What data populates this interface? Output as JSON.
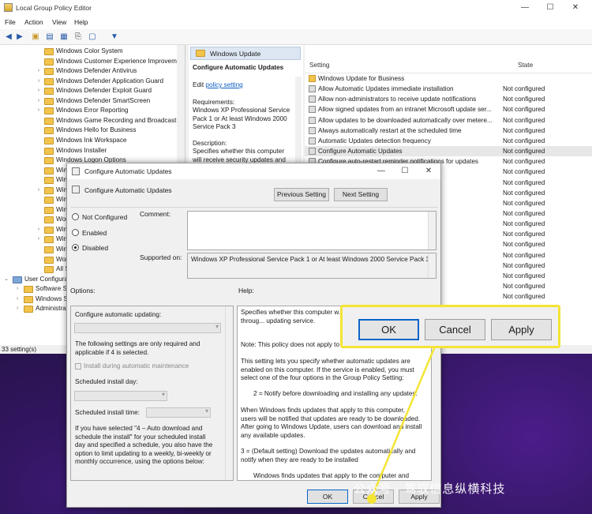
{
  "window": {
    "title": "Local Group Policy Editor",
    "minimize": "—",
    "maximize": "☐",
    "close": "✕"
  },
  "menu": [
    "File",
    "Action",
    "View",
    "Help"
  ],
  "tree": {
    "items": [
      {
        "label": "Windows Color System",
        "chev": ""
      },
      {
        "label": "Windows Customer Experience Improvem",
        "chev": ""
      },
      {
        "label": "Windows Defender Antivirus",
        "chev": "›"
      },
      {
        "label": "Windows Defender Application Guard",
        "chev": "›"
      },
      {
        "label": "Windows Defender Exploit Guard",
        "chev": "›"
      },
      {
        "label": "Windows Defender SmartScreen",
        "chev": "›"
      },
      {
        "label": "Windows Error Reporting",
        "chev": "›"
      },
      {
        "label": "Windows Game Recording and Broadcasti",
        "chev": ""
      },
      {
        "label": "Windows Hello for Business",
        "chev": ""
      },
      {
        "label": "Windows Ink Workspace",
        "chev": ""
      },
      {
        "label": "Windows Installer",
        "chev": ""
      },
      {
        "label": "Windows Logon Options",
        "chev": ""
      },
      {
        "label": "Win",
        "chev": ""
      },
      {
        "label": "Win",
        "chev": ""
      },
      {
        "label": "Win",
        "chev": "›"
      },
      {
        "label": "Win",
        "chev": ""
      },
      {
        "label": "Win",
        "chev": ""
      },
      {
        "label": "Wor",
        "chev": ""
      },
      {
        "label": "Win",
        "chev": "›"
      },
      {
        "label": "Win",
        "chev": "›"
      },
      {
        "label": "Win",
        "chev": ""
      },
      {
        "label": "Wor",
        "chev": ""
      },
      {
        "label": "All Setti",
        "chev": ""
      }
    ],
    "user_config": "User Configura",
    "sub": [
      "Software S",
      "Windows S",
      "Administra"
    ]
  },
  "desc": {
    "header": "Windows Update",
    "title": "Configure Automatic Updates",
    "edit_prefix": "Edit ",
    "edit_link": "policy setting",
    "req_label": "Requirements:",
    "req_text": "Windows XP Professional Service Pack 1 or At least Windows 2000 Service Pack 3",
    "desc_label": "Description:",
    "desc_text": "Specifies whether this computer will receive security updates and"
  },
  "list": {
    "col_setting": "Setting",
    "col_state": "State",
    "rows": [
      {
        "name": "Windows Update for Business",
        "state": "",
        "folder": true
      },
      {
        "name": "Allow Automatic Updates immediate installation",
        "state": "Not configured"
      },
      {
        "name": "Allow non-administrators to receive update notifications",
        "state": "Not configured"
      },
      {
        "name": "Allow signed updates from an intranet Microsoft update ser...",
        "state": "Not configured"
      },
      {
        "name": "Allow updates to be downloaded automatically over metere...",
        "state": "Not configured"
      },
      {
        "name": "Always automatically restart at the scheduled time",
        "state": "Not configured"
      },
      {
        "name": "Automatic Updates detection frequency",
        "state": "Not configured"
      },
      {
        "name": "Configure Automatic Updates",
        "state": "Not configured",
        "selected": true
      },
      {
        "name": "Configure auto-restart reminder notifications for updates",
        "state": "Not configured"
      },
      {
        "name": "for updates",
        "state": "Not configured"
      },
      {
        "name": "s schedule for u...",
        "state": "Not configured"
      },
      {
        "name": "",
        "state": "Not configured"
      },
      {
        "name": "",
        "state": "Not configured"
      },
      {
        "name": "ates and Shut Do...",
        "state": "Not configured"
      },
      {
        "name": "pse scans against ...",
        "state": "Not configured"
      },
      {
        "name": "ernet locations",
        "state": "Not configured"
      },
      {
        "name": "own' option in Sh...",
        "state": "Not configured"
      },
      {
        "name": "for updates",
        "state": "Not configured"
      },
      {
        "name": "",
        "state": "Not configured"
      },
      {
        "name": "nent to automati...",
        "state": "Not configured"
      },
      {
        "name": "cheduled automat...",
        "state": "Not configured"
      },
      {
        "name": "",
        "state": "Not configured"
      }
    ]
  },
  "status": "33 setting(s)",
  "dialog": {
    "title": "Configure Automatic Updates",
    "heading": "Configure Automatic Updates",
    "prev": "Previous Setting",
    "next": "Next Setting",
    "radio_nc": "Not Configured",
    "radio_en": "Enabled",
    "radio_dis": "Disabled",
    "comment_label": "Comment:",
    "supported_label": "Supported on:",
    "supported_text": "Windows XP Professional Service Pack 1 or At least Windows 2000 Service Pack 3",
    "options_label": "Options:",
    "help_label": "Help:",
    "opt_configure": "Configure automatic updating:",
    "opt_note": "The following settings are only required and applicable if 4 is selected.",
    "opt_install_maint": "Install during automatic maintenance",
    "opt_day": "Scheduled install day:",
    "opt_time": "Scheduled install time:",
    "opt_para": "If you have selected \"4 – Auto download and schedule the install\" for your scheduled install day and specified a schedule, you also have the option to limit updating to a weekly, bi-weekly or monthly occurrence, using the options below:",
    "help_1": "Specifies whether this computer w... other important downloads throug... updating service.",
    "help_2": "Note: This policy does not apply to",
    "help_3": "This setting lets you specify whether automatic updates are enabled on this computer. If the service is enabled, you must select one of the four options in the Group Policy Setting:",
    "help_4": "2 = Notify before downloading and installing any updates.",
    "help_5": "When Windows finds updates that apply to this computer, users will be notified that updates are ready to be downloaded. After going to Windows Update, users can download and install any available updates.",
    "help_6": "3 = (Default setting) Download the updates automatically and notify when they are ready to be installed",
    "help_7": "Windows finds updates that apply to the computer and",
    "ok": "OK",
    "cancel": "Cancel",
    "apply": "Apply"
  },
  "zoom": {
    "ok": "OK",
    "cancel": "Cancel",
    "apply": "Apply"
  },
  "watermark": "公众号 · 驾驭信息纵横科技",
  "colors": {
    "highlight": "#f4e435",
    "default_button_border": "#0a64c8"
  }
}
